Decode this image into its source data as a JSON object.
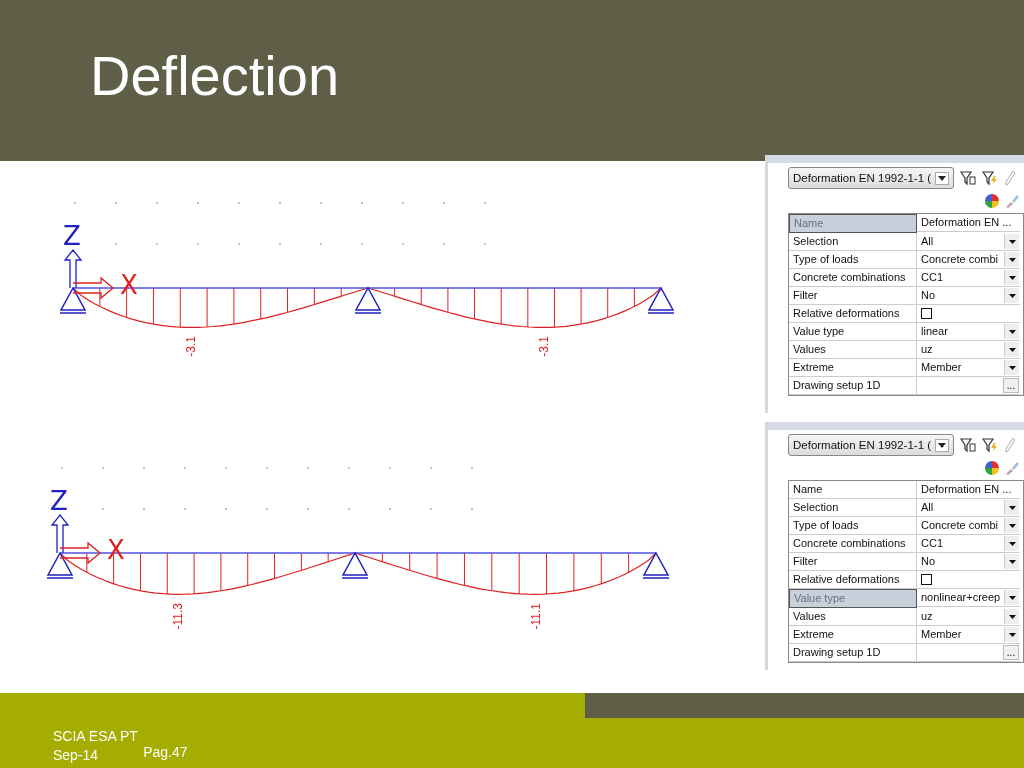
{
  "slide": {
    "title": "Deflection"
  },
  "diagrams": [
    {
      "axis_z": "Z",
      "axis_x": "X",
      "span_values": [
        "-3.1",
        "-3.1"
      ]
    },
    {
      "axis_z": "Z",
      "axis_x": "X",
      "span_values": [
        "-11.3",
        "-11.1"
      ]
    }
  ],
  "panels": [
    {
      "selector": "Deformation EN 1992-1-1 (",
      "rows": [
        {
          "label": "Name",
          "value": "Deformation EN ...",
          "kind": "text",
          "selected": true
        },
        {
          "label": "Selection",
          "value": "All",
          "kind": "dropdown",
          "selected": false
        },
        {
          "label": "Type of loads",
          "value": "Concrete combi",
          "kind": "dropdown",
          "selected": false
        },
        {
          "label": "Concrete combinations",
          "value": "CC1",
          "kind": "dropdown",
          "selected": false
        },
        {
          "label": "Filter",
          "value": "No",
          "kind": "dropdown",
          "selected": false
        },
        {
          "label": "Relative deformations",
          "checked": false,
          "kind": "checkbox",
          "selected": false
        },
        {
          "label": "Value type",
          "value": "linear",
          "kind": "dropdown",
          "selected": false
        },
        {
          "label": "Values",
          "value": "uz",
          "kind": "dropdown",
          "selected": false
        },
        {
          "label": "Extreme",
          "value": "Member",
          "kind": "dropdown",
          "selected": false
        },
        {
          "label": "Drawing setup 1D",
          "button": "...",
          "kind": "button",
          "selected": false
        }
      ]
    },
    {
      "selector": "Deformation EN 1992-1-1 (",
      "rows": [
        {
          "label": "Name",
          "value": "Deformation EN ...",
          "kind": "text",
          "selected": false
        },
        {
          "label": "Selection",
          "value": "All",
          "kind": "dropdown",
          "selected": false
        },
        {
          "label": "Type of loads",
          "value": "Concrete combi",
          "kind": "dropdown",
          "selected": false
        },
        {
          "label": "Concrete combinations",
          "value": "CC1",
          "kind": "dropdown",
          "selected": false
        },
        {
          "label": "Filter",
          "value": "No",
          "kind": "dropdown",
          "selected": false
        },
        {
          "label": "Relative deformations",
          "checked": false,
          "kind": "checkbox",
          "selected": false
        },
        {
          "label": "Value type",
          "value": "nonlinear+creep",
          "kind": "dropdown",
          "selected": true
        },
        {
          "label": "Values",
          "value": "uz",
          "kind": "dropdown",
          "selected": false
        },
        {
          "label": "Extreme",
          "value": "Member",
          "kind": "dropdown",
          "selected": false
        },
        {
          "label": "Drawing setup 1D",
          "button": "...",
          "kind": "button",
          "selected": false
        }
      ]
    }
  ],
  "footer": {
    "company": "SCIA ESA PT",
    "date": "Sep-14",
    "page": "Pag.47"
  }
}
